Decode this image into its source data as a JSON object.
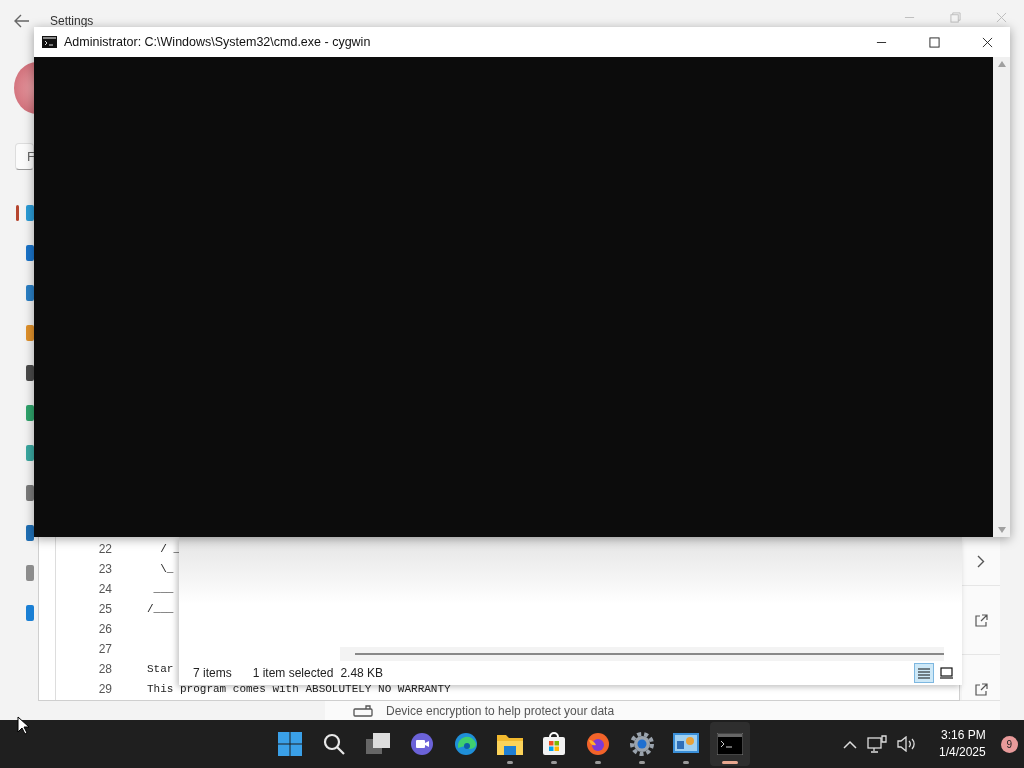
{
  "settings_window": {
    "title": "Settings",
    "search": {
      "placeholder": "F"
    },
    "nav_items": [
      {
        "selected": true,
        "color": "#2b9bd6"
      },
      {
        "selected": false,
        "color": "#1a73c9"
      },
      {
        "selected": false,
        "color": "#2a7fc4"
      },
      {
        "selected": false,
        "color": "#e0912b"
      },
      {
        "selected": false,
        "color": "#4a4a4a"
      },
      {
        "selected": false,
        "color": "#2fa36b"
      },
      {
        "selected": false,
        "color": "#3aa7a0"
      },
      {
        "selected": false,
        "color": "#7a7a7a"
      },
      {
        "selected": false,
        "color": "#1f6fb5"
      },
      {
        "selected": false,
        "color": "#8c8c8c"
      },
      {
        "selected": false,
        "color": "#1a7fd4"
      }
    ],
    "cards": [
      {
        "kind": "chevron"
      },
      {
        "kind": "external"
      },
      {
        "kind": "external"
      }
    ],
    "encryption_row": {
      "text": "Device encryption to help protect your data"
    }
  },
  "editor_window": {
    "lines": [
      {
        "number": "22",
        "text": "  / _"
      },
      {
        "number": "23",
        "text": "  \\_"
      },
      {
        "number": "24",
        "text": " ___"
      },
      {
        "number": "25",
        "text": "/___"
      },
      {
        "number": "26"
      },
      {
        "number": "27"
      },
      {
        "number": "28",
        "text": "Star"
      },
      {
        "number": "29",
        "text": "This program comes with ABSOLUTELY NO WARRANTY"
      }
    ]
  },
  "explorer_window": {
    "status_bar": {
      "item_count": "7 items",
      "selection": "1 item selected",
      "size": "2.48 KB"
    },
    "view_buttons": [
      {
        "kind": "details",
        "selected": true
      },
      {
        "kind": "tiles",
        "selected": false
      }
    ]
  },
  "cmd_window": {
    "title": "Administrator: C:\\Windows\\System32\\cmd.exe - cygwin"
  },
  "taskbar": {
    "apps": [
      {
        "kind": "start",
        "running": false,
        "active": false
      },
      {
        "kind": "search",
        "running": false,
        "active": false
      },
      {
        "kind": "taskview",
        "running": false,
        "active": false
      },
      {
        "kind": "chat",
        "running": false,
        "active": false
      },
      {
        "kind": "edge",
        "running": false,
        "active": false
      },
      {
        "kind": "folder",
        "running": true,
        "active": false
      },
      {
        "kind": "store",
        "running": true,
        "active": false
      },
      {
        "kind": "firefox",
        "running": true,
        "active": false
      },
      {
        "kind": "gear",
        "running": true,
        "active": false
      },
      {
        "kind": "panel",
        "running": true,
        "active": false
      },
      {
        "kind": "terminal",
        "running": true,
        "active": true
      }
    ],
    "clock": {
      "time": "3:16 PM",
      "date": "1/4/2025"
    },
    "notifications": "9"
  }
}
